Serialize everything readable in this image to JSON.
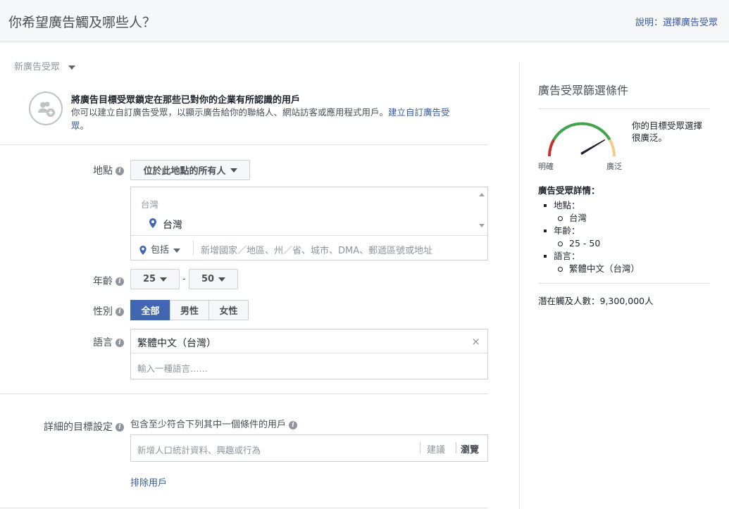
{
  "header": {
    "title": "你希望廣告觸及哪些人？",
    "help_link": "說明：選擇廣告受眾"
  },
  "audience": {
    "selector_label": "新廣告受眾"
  },
  "custom_audience": {
    "title": "將廣告目標受眾鎖定在那些已對你的企業有所認識的用戶",
    "description": "你可以建立自訂廣告受眾，以顯示廣告給你的聯絡人、網站訪客或應用程式用戶。",
    "link": "建立自訂廣告受眾",
    "period": "。"
  },
  "location": {
    "label": "地點",
    "dropdown": "位於此地點的所有人",
    "group": "台灣",
    "selected": "台灣",
    "include_label": "包括",
    "placeholder": "新增國家／地區、州／省、城市、DMA、郵遞區號或地址"
  },
  "age": {
    "label": "年齡",
    "min": "25",
    "dash": "-",
    "max": "50"
  },
  "gender": {
    "label": "性別",
    "options": [
      "全部",
      "男性",
      "女性"
    ],
    "selected": "全部"
  },
  "language": {
    "label": "語言",
    "selected": "繁體中文（台灣）",
    "remove": "×",
    "placeholder": "輸入一種語言……"
  },
  "detailed_targeting": {
    "label": "詳細的目標設定",
    "subtitle": "包含至少符合下列其中一個條件的用戶",
    "placeholder": "新增人口統計資料、興趣或行為",
    "suggestions": "建議",
    "browse": "瀏覽",
    "exclude": "排除用戶"
  },
  "sidebar": {
    "title": "廣告受眾篩選條件",
    "gauge": {
      "left_label": "明確",
      "right_label": "廣泛",
      "message": "你的目標受眾選擇很廣泛。",
      "level": 0.78
    },
    "details_title": "廣告受眾詳情：",
    "details": [
      {
        "key": "地點：",
        "value": "台灣"
      },
      {
        "key": "年齡：",
        "value": "25 - 50"
      },
      {
        "key": "語言：",
        "value": "繁體中文（台灣）"
      }
    ],
    "potential_reach": "潛在觸及人數：9,300,000人"
  },
  "colors": {
    "accent": "#4267b2",
    "link": "#365899",
    "gauge_red": "#c9302c",
    "gauge_green": "#42a44c",
    "gauge_orange": "#f5c98a"
  }
}
